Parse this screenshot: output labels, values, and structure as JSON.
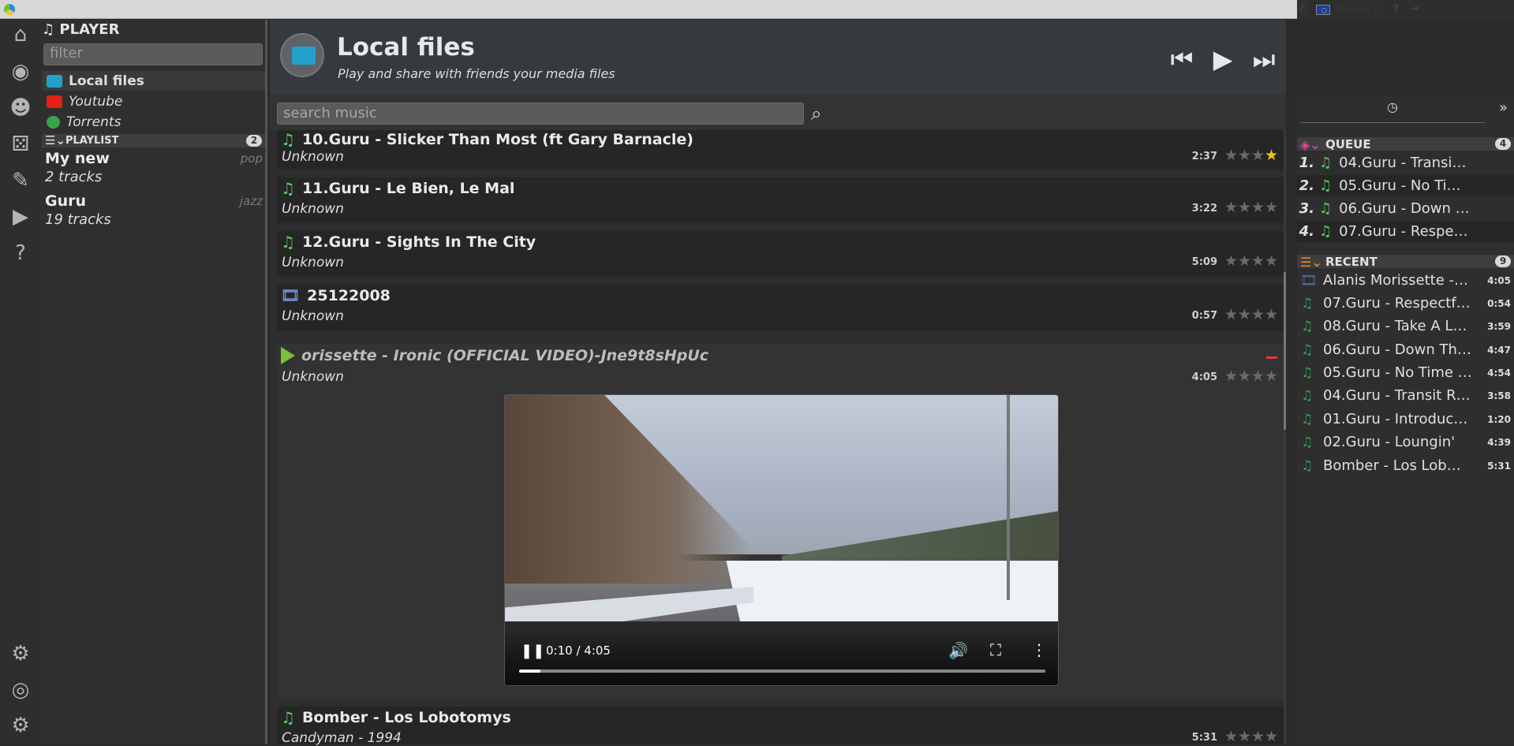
{
  "topbar": {
    "user": "Pavel P."
  },
  "iconbar": {
    "items": [
      {
        "name": "home-icon",
        "glyph": "⌂"
      },
      {
        "name": "globe-icon",
        "glyph": "◉"
      },
      {
        "name": "people-icon",
        "glyph": "☻"
      },
      {
        "name": "dice-icon",
        "glyph": "⚄"
      },
      {
        "name": "edit-icon",
        "glyph": "✎"
      },
      {
        "name": "play-nav-icon",
        "glyph": "▶"
      },
      {
        "name": "help-icon",
        "glyph": "?"
      }
    ],
    "bottom": [
      {
        "name": "group-settings-icon",
        "glyph": "⚙"
      },
      {
        "name": "support-icon",
        "glyph": "◎"
      },
      {
        "name": "settings-icon",
        "glyph": "⚙"
      }
    ]
  },
  "sidebar": {
    "title": "PLAYER",
    "filter_placeholder": "filter",
    "sources": [
      {
        "label": "Local files",
        "color": "#22a2c8"
      },
      {
        "label": "Youtube",
        "color": "#e62117"
      },
      {
        "label": "Torrents",
        "color": "#3aa34a"
      }
    ],
    "playlist_header": "PLAYLIST",
    "playlist_count": "2",
    "playlists": [
      {
        "name": "My new",
        "genre": "pop",
        "count": "2 tracks"
      },
      {
        "name": "Guru",
        "genre": "jazz",
        "count": "19 tracks"
      }
    ]
  },
  "main": {
    "title": "Local files",
    "subtitle": "Play and share with friends your media files",
    "search_placeholder": "search music",
    "tracks": [
      {
        "title": "10.Guru - Slicker Than Most (ft Gary Barnacle)",
        "artist": "Unknown",
        "duration": "2:37",
        "stars": "★★★",
        "star_on": "★",
        "kind": "audio"
      },
      {
        "title": "11.Guru - Le Bien, Le Mal",
        "artist": "Unknown",
        "duration": "3:22",
        "stars": "★★★★",
        "star_on": "",
        "kind": "audio"
      },
      {
        "title": "12.Guru - Sights In The City",
        "artist": "Unknown",
        "duration": "5:09",
        "stars": "★★★★",
        "star_on": "",
        "kind": "audio"
      },
      {
        "title": "25122008",
        "artist": "Unknown",
        "duration": "0:57",
        "stars": "★★★★",
        "star_on": "",
        "kind": "video"
      }
    ],
    "playing": {
      "title": "orissette - Ironic (OFFICIAL VIDEO)-Jne9t8sHpUc",
      "artist": "Unknown",
      "duration": "4:05",
      "stars": "★★★★",
      "video_time": "0:10 / 4:05",
      "progress": 0.04
    },
    "next_track": {
      "title": "Bomber - Los Lobotomys",
      "artist": "Candyman - 1994",
      "duration": "5:31",
      "stars": "★★★★"
    }
  },
  "right": {
    "queue_header": "QUEUE",
    "queue_count": "4",
    "queue": [
      {
        "num": "1.",
        "title": "04.Guru - Transi…"
      },
      {
        "num": "2.",
        "title": "05.Guru - No Ti…"
      },
      {
        "num": "3.",
        "title": "06.Guru - Down …"
      },
      {
        "num": "4.",
        "title": "07.Guru - Respe…"
      }
    ],
    "recent_header": "RECENT",
    "recent_count": "9",
    "recent": [
      {
        "title": "Alanis Morissette -…",
        "duration": "4:05",
        "kind": "video"
      },
      {
        "title": "07.Guru - Respectf…",
        "duration": "0:54",
        "kind": "audio"
      },
      {
        "title": "08.Guru - Take A L…",
        "duration": "3:59",
        "kind": "audio"
      },
      {
        "title": "06.Guru - Down Th…",
        "duration": "4:47",
        "kind": "audio"
      },
      {
        "title": "05.Guru - No Time …",
        "duration": "4:54",
        "kind": "audio"
      },
      {
        "title": "04.Guru - Transit R…",
        "duration": "3:58",
        "kind": "audio"
      },
      {
        "title": "01.Guru - Introduc…",
        "duration": "1:20",
        "kind": "audio"
      },
      {
        "title": "02.Guru - Loungin'",
        "duration": "4:39",
        "kind": "audio"
      },
      {
        "title": "Bomber - Los Lob…",
        "duration": "5:31",
        "kind": "audio"
      }
    ]
  }
}
